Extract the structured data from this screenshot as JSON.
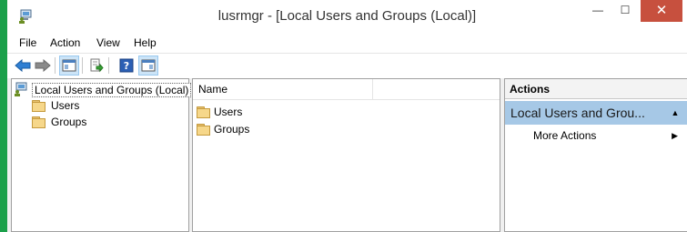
{
  "window": {
    "title": "lusrmgr - [Local Users and Groups (Local)]",
    "controls": {
      "minimize": "—",
      "maximize": "☐",
      "close": "✕"
    }
  },
  "menu": [
    "File",
    "Action",
    "View",
    "Help"
  ],
  "toolbar": {
    "buttons": [
      "back-arrow-icon",
      "forward-arrow-icon",
      "show-hide-console-tree-icon",
      "export-list-icon",
      "help-icon",
      "show-hide-action-pane-icon"
    ]
  },
  "tree": {
    "root": "Local Users and Groups (Local)",
    "children": [
      "Users",
      "Groups"
    ]
  },
  "list": {
    "column_name": "Name",
    "items": [
      "Users",
      "Groups"
    ]
  },
  "actions": {
    "header": "Actions",
    "group_title": "Local Users and Grou...",
    "more_actions": "More Actions"
  },
  "colors": {
    "desktop": "#1ba04a",
    "close_button": "#c7503e",
    "selected_group": "#a6c8e6"
  }
}
